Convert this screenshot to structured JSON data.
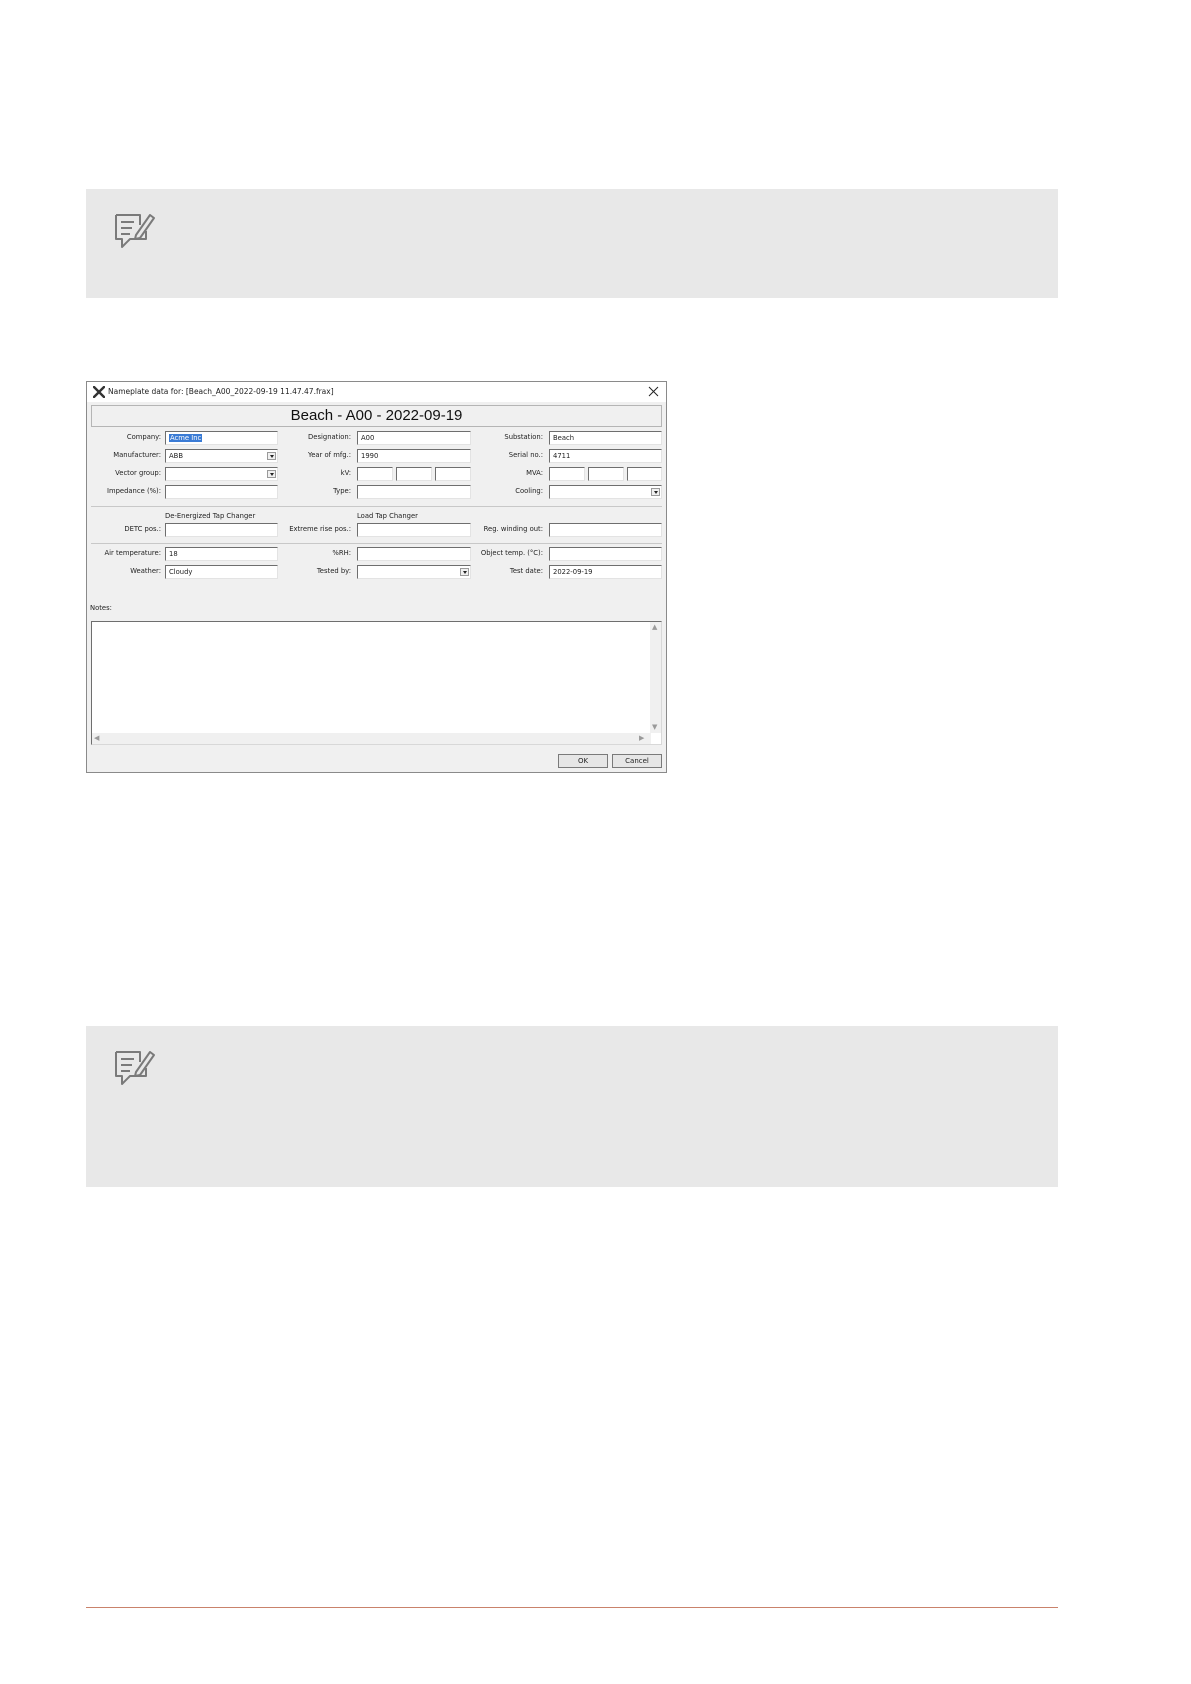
{
  "dialog": {
    "title": "Nameplate data for: [Beach_A00_2022-09-19 11.47.47.frax]",
    "header": "Beach - A00 - 2022-09-19",
    "fields": {
      "company": {
        "label": "Company:",
        "value": "Acme Inc"
      },
      "designation": {
        "label": "Designation:",
        "value": "A00"
      },
      "substation": {
        "label": "Substation:",
        "value": "Beach"
      },
      "manufacturer": {
        "label": "Manufacturer:",
        "value": "ABB"
      },
      "year_of_mfg": {
        "label": "Year of mfg.:",
        "value": "1990"
      },
      "serial_no": {
        "label": "Serial no.:",
        "value": "4711"
      },
      "vector_group": {
        "label": "Vector group:",
        "value": ""
      },
      "kv": {
        "label": "kV:",
        "values": [
          "",
          "",
          ""
        ]
      },
      "mva": {
        "label": "MVA:",
        "values": [
          "",
          "",
          ""
        ]
      },
      "impedance": {
        "label": "Impedance (%):",
        "value": ""
      },
      "type": {
        "label": "Type:",
        "value": ""
      },
      "cooling": {
        "label": "Cooling:",
        "value": ""
      },
      "detc_pos": {
        "label": "DETC pos.:",
        "value": ""
      },
      "extreme_rise_pos": {
        "label": "Extreme rise pos.:",
        "value": ""
      },
      "reg_winding_out": {
        "label": "Reg. winding out:",
        "value": ""
      },
      "air_temperature": {
        "label": "Air temperature:",
        "value": "18"
      },
      "rh": {
        "label": "%RH:",
        "value": ""
      },
      "object_temp": {
        "label": "Object temp. (°C):",
        "value": ""
      },
      "weather": {
        "label": "Weather:",
        "value": "Cloudy"
      },
      "tested_by": {
        "label": "Tested by:",
        "value": ""
      },
      "test_date": {
        "label": "Test date:",
        "value": "2022-09-19"
      }
    },
    "sections": {
      "detc": "De-Energized Tap Changer",
      "ltc": "Load Tap Changer"
    },
    "notes_label": "Notes:",
    "notes_value": "",
    "ok_label": "OK",
    "cancel_label": "Cancel"
  },
  "icons": {
    "note": "note-pencil-icon",
    "app": "x-app-icon",
    "close": "close-icon"
  }
}
